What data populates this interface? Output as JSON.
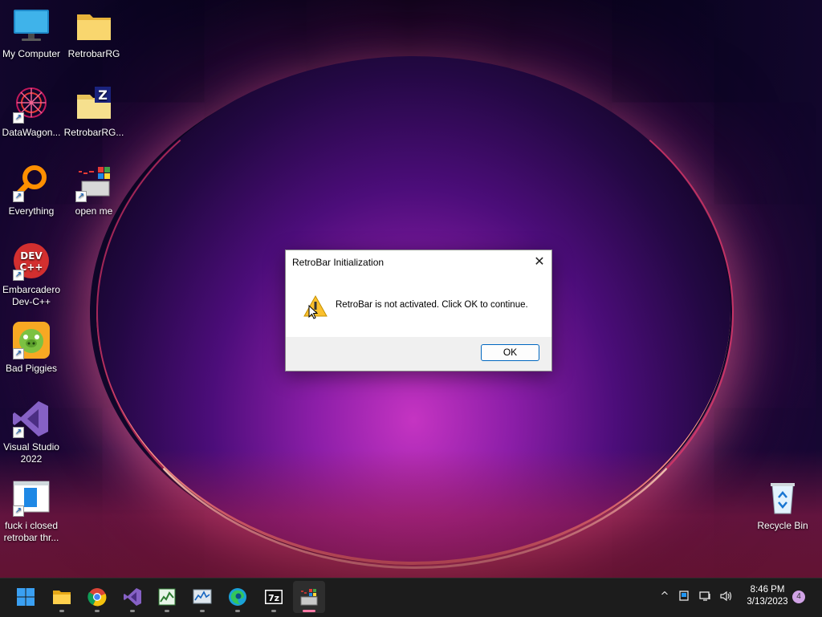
{
  "desktop": {
    "icons": [
      {
        "label": "My Computer",
        "icon": "monitor-icon"
      },
      {
        "label": "RetrobarRG",
        "icon": "folder-icon"
      },
      {
        "label": "DataWagon...",
        "icon": "datawagon-icon"
      },
      {
        "label": "RetrobarRG...",
        "icon": "zip-folder-icon"
      },
      {
        "label": "Everything",
        "icon": "everything-search-icon"
      },
      {
        "label": "open me",
        "icon": "retro-window-icon"
      },
      {
        "label": "Embarcadero Dev-C++",
        "icon": "devcpp-icon"
      },
      {
        "label": "Bad Piggies",
        "icon": "bad-piggies-icon"
      },
      {
        "label": "Visual Studio 2022",
        "icon": "visual-studio-icon"
      },
      {
        "label": "fuck i closed retrobar thr...",
        "icon": "text-document-icon"
      },
      {
        "label": "Recycle Bin",
        "icon": "recycle-bin-icon"
      }
    ]
  },
  "dialog": {
    "title": "RetroBar Initialization",
    "message": "RetroBar is not activated. Click OK to continue.",
    "ok_label": "OK",
    "close_glyph": "✕"
  },
  "taskbar": {
    "items": [
      "start-icon",
      "file-explorer-icon",
      "chrome-icon",
      "visual-studio-icon",
      "task-manager-icon",
      "resource-monitor-icon",
      "edge-icon",
      "7zip-icon",
      "retrobar-icon"
    ],
    "active_item": "retrobar-icon",
    "tray": {
      "chevron": "^",
      "clock_time": "8:46 PM",
      "clock_date": "3/13/2023",
      "notification_count": "4"
    }
  },
  "colors": {
    "taskbar_bg": "#1c1c1c",
    "accent": "#0067c0",
    "active_indicator": "#ff7aa6",
    "dialog_footer": "#f0f0f0"
  }
}
